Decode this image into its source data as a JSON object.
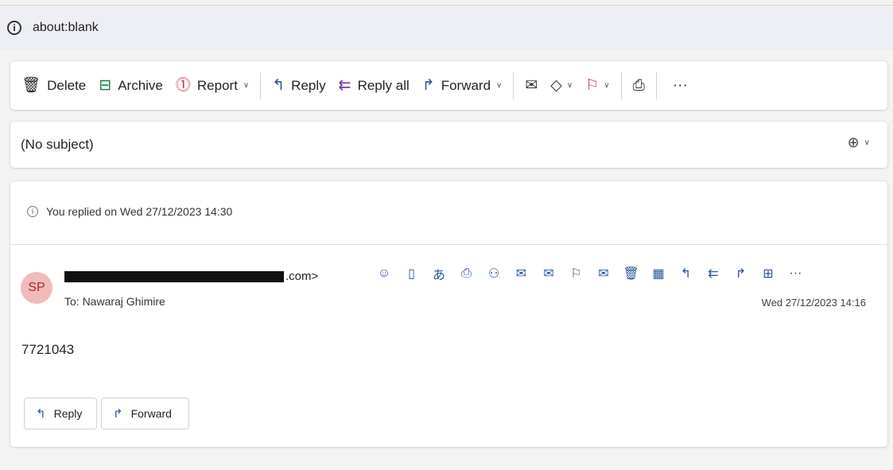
{
  "browser": {
    "url": "about:blank"
  },
  "toolbar": {
    "delete": "Delete",
    "archive": "Archive",
    "report": "Report",
    "reply": "Reply",
    "reply_all": "Reply all",
    "forward": "Forward",
    "more": "···"
  },
  "subject": {
    "title": "(No subject)"
  },
  "message": {
    "replied_notice": "You replied on Wed 27/12/2023 14:30",
    "avatar_initials": "SP",
    "sender_suffix": ".com>",
    "to_line": "To: Nawaraj Ghimire",
    "date": "Wed 27/12/2023 14:16",
    "body": "7721043",
    "more": "···",
    "reply_button": "Reply",
    "forward_button": "Forward"
  },
  "colors": {
    "accent": "#2b5797",
    "flag": "#c4314b",
    "avatar_bg": "#f1bbbc",
    "avatar_text": "#a4262c"
  }
}
